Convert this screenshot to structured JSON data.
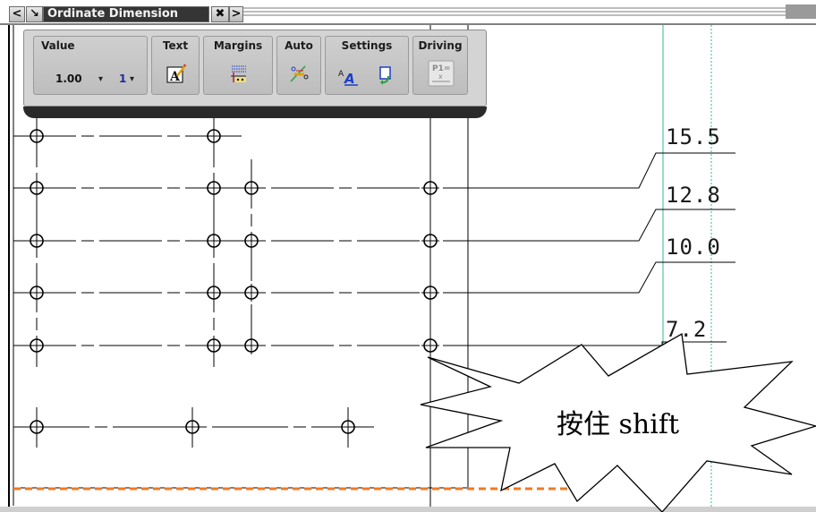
{
  "toolbar": {
    "title": "Ordinate Dimension",
    "prev_glyph": "<",
    "next_glyph": ">",
    "pin_glyph": "↘",
    "close_glyph": "✖",
    "groups": {
      "value": {
        "label": "Value",
        "value": "1.00",
        "tolerance": "1"
      },
      "text": {
        "label": "Text",
        "icon": "text-style-icon"
      },
      "margins": {
        "label": "Margins",
        "icon": "margins-icon"
      },
      "auto": {
        "label": "Auto",
        "icon": "auto-dimension-icon"
      },
      "settings": {
        "label": "Settings",
        "icon": "text-settings-icon"
      },
      "driving": {
        "label": "Driving",
        "icon": "driving-icon"
      }
    }
  },
  "dimensions": [
    "15.5",
    "12.8",
    "10.0",
    "7.2"
  ],
  "callout": {
    "text": "按住 shift"
  },
  "colors": {
    "guide_line": "#2fb89a",
    "dashed_border": "#f07a20",
    "toolbar_dark": "#353535"
  }
}
